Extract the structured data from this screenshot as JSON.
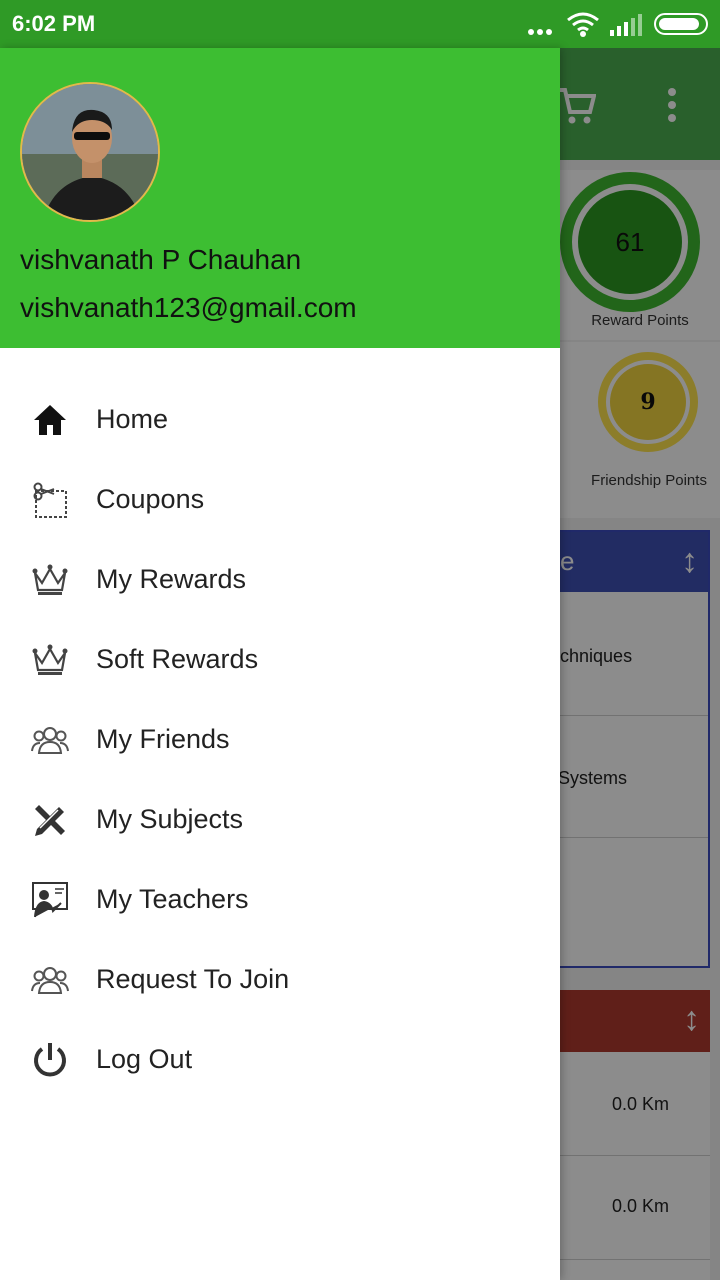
{
  "status_bar": {
    "time": "6:02 PM"
  },
  "background": {
    "reward_points_value": "61",
    "reward_points_label": "Reward Points",
    "friendship_points_value": "9",
    "friendship_points_label": "Friendship Points",
    "panel1_header_partial": "e",
    "panel1_rows": [
      "echniques",
      "Systems"
    ],
    "panel2_rows": [
      "0.0 Km",
      "0.0 Km"
    ]
  },
  "drawer": {
    "user_name": "vishvanath P Chauhan",
    "user_email": "vishvanath123@gmail.com",
    "items": [
      {
        "label": "Home",
        "icon": "home-icon"
      },
      {
        "label": "Coupons",
        "icon": "scissors-coupon-icon"
      },
      {
        "label": "My Rewards",
        "icon": "crown-icon"
      },
      {
        "label": "Soft Rewards",
        "icon": "crown-icon"
      },
      {
        "label": "My Friends",
        "icon": "group-icon"
      },
      {
        "label": "My Subjects",
        "icon": "pencil-ruler-icon"
      },
      {
        "label": "My Teachers",
        "icon": "teacher-icon"
      },
      {
        "label": "Request To Join",
        "icon": "group-icon"
      },
      {
        "label": "Log Out",
        "icon": "power-icon"
      }
    ]
  },
  "colors": {
    "status_bar": "#2f9a26",
    "header": "#3dbe32",
    "panel_blue": "#3f51b5",
    "panel_red": "#b03a2e"
  }
}
